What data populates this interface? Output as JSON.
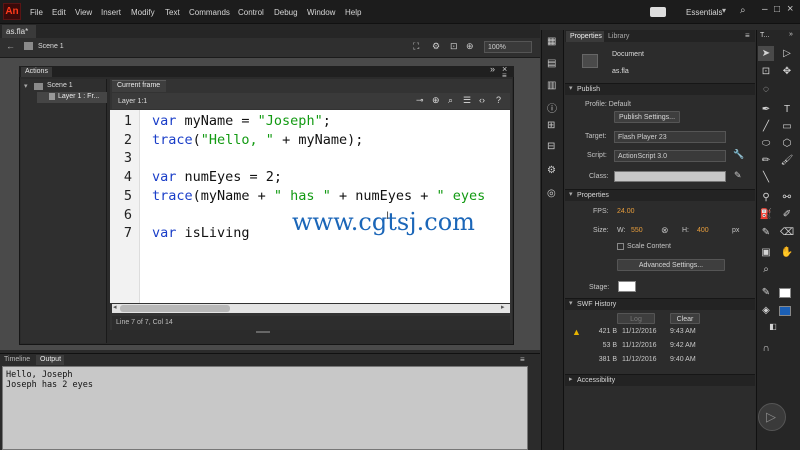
{
  "app": {
    "logo": "An",
    "workspace": "Essentials"
  },
  "menu": [
    "File",
    "Edit",
    "View",
    "Insert",
    "Modify",
    "Text",
    "Commands",
    "Control",
    "Debug",
    "Window",
    "Help"
  ],
  "document": {
    "tab": "as.fla*",
    "scene": "Scene 1",
    "zoom": "100%"
  },
  "actions": {
    "panel_title": "Actions",
    "tree": [
      "Scene 1",
      "Layer 1 : Fr..."
    ],
    "tab": "Current frame",
    "layer": "Layer 1:1",
    "code_lines": [
      {
        "n": "1",
        "parts": [
          {
            "t": "var",
            "c": "kw"
          },
          {
            "t": " myName = ",
            "c": ""
          },
          {
            "t": "\"Joseph\"",
            "c": "str"
          },
          {
            "t": ";",
            "c": ""
          }
        ]
      },
      {
        "n": "2",
        "parts": [
          {
            "t": "trace",
            "c": "fn"
          },
          {
            "t": "(",
            "c": ""
          },
          {
            "t": "\"Hello, \"",
            "c": "str"
          },
          {
            "t": " + myName);",
            "c": ""
          }
        ]
      },
      {
        "n": "3",
        "parts": []
      },
      {
        "n": "4",
        "parts": [
          {
            "t": "var",
            "c": "kw"
          },
          {
            "t": " numEyes = 2;",
            "c": ""
          }
        ]
      },
      {
        "n": "5",
        "parts": [
          {
            "t": "trace",
            "c": "fn"
          },
          {
            "t": "(myName + ",
            "c": ""
          },
          {
            "t": "\" has \"",
            "c": "str"
          },
          {
            "t": " + numEyes + ",
            "c": ""
          },
          {
            "t": "\" eyes",
            "c": "str"
          }
        ]
      },
      {
        "n": "6",
        "parts": []
      },
      {
        "n": "7",
        "parts": [
          {
            "t": "var",
            "c": "kw"
          },
          {
            "t": " isLiving",
            "c": ""
          }
        ]
      }
    ],
    "status": "Line 7 of 7, Col 14"
  },
  "watermark": "www.cgtsj.com",
  "bottom": {
    "tabs": [
      "Timeline",
      "Output"
    ],
    "output": "Hello, Joseph\nJoseph has 2 eyes"
  },
  "properties": {
    "tabs": [
      "Properties",
      "Library"
    ],
    "doc_label": "Document",
    "doc_name": "as.fla",
    "publish": {
      "title": "Publish",
      "profile": "Profile: Default",
      "settings_btn": "Publish Settings...",
      "target_label": "Target:",
      "target": "Flash Player 23",
      "script_label": "Script:",
      "script": "ActionScript 3.0",
      "class_label": "Class:"
    },
    "props": {
      "title": "Properties",
      "fps_label": "FPS:",
      "fps": "24.00",
      "size_label": "Size:",
      "w_label": "W:",
      "w": "550",
      "h_label": "H:",
      "h": "400",
      "unit": "px",
      "scale": "Scale Content",
      "adv_btn": "Advanced Settings...",
      "stage_label": "Stage:"
    },
    "swf": {
      "title": "SWF History",
      "log_btn": "Log",
      "clear_btn": "Clear",
      "rows": [
        {
          "size": "421 B",
          "date": "11/12/2016",
          "time": "9:43 AM"
        },
        {
          "size": "53 B",
          "date": "11/12/2016",
          "time": "9:42 AM"
        },
        {
          "size": "381 B",
          "date": "11/12/2016",
          "time": "9:40 AM"
        }
      ]
    },
    "access": {
      "title": "Accessibility"
    }
  },
  "tools_title": "T..."
}
